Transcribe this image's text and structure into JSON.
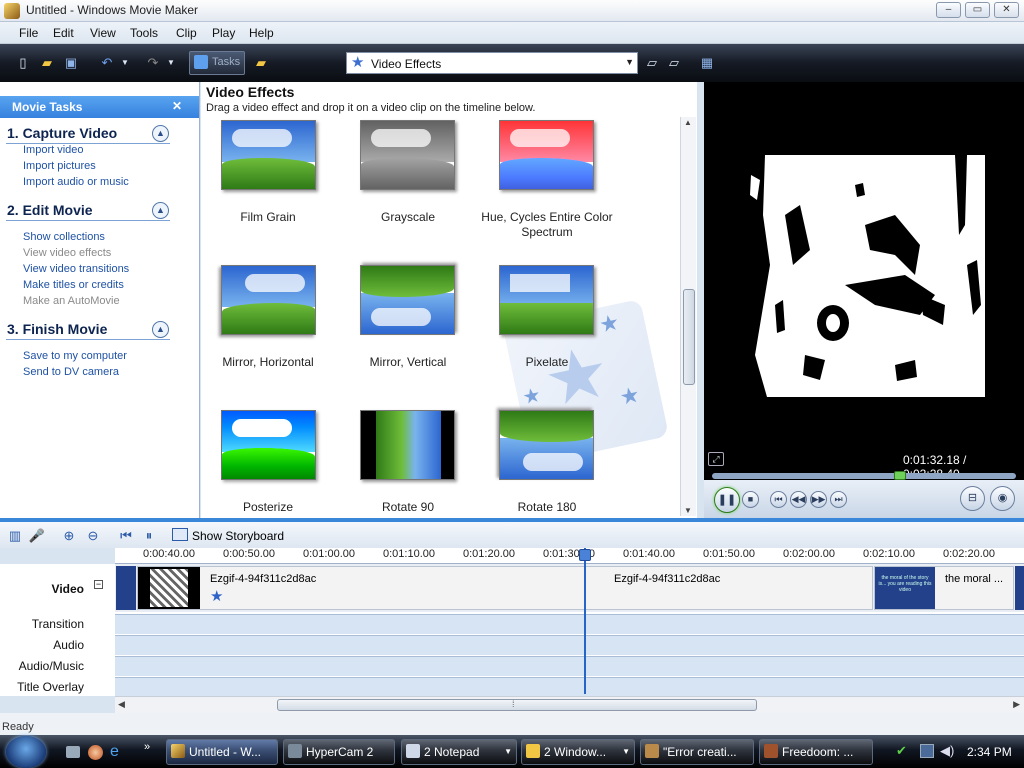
{
  "window": {
    "title": "Untitled - Windows Movie Maker",
    "minimize": "–",
    "maximize": "▭",
    "close": "✕"
  },
  "menu": [
    "File",
    "Edit",
    "View",
    "Tools",
    "Clip",
    "Play",
    "Help"
  ],
  "toolbar": {
    "tasks_label": "Tasks",
    "collections_select": "Video Effects"
  },
  "movie_tasks": {
    "header": "Movie Tasks",
    "sections": [
      {
        "title": "1. Capture Video",
        "links": [
          {
            "label": "Import video",
            "enabled": true
          },
          {
            "label": "Import pictures",
            "enabled": true
          },
          {
            "label": "Import audio or music",
            "enabled": true
          }
        ]
      },
      {
        "title": "2. Edit Movie",
        "links": [
          {
            "label": "Show collections",
            "enabled": true
          },
          {
            "label": "View video effects",
            "enabled": false
          },
          {
            "label": "View video transitions",
            "enabled": true
          },
          {
            "label": "Make titles or credits",
            "enabled": true
          },
          {
            "label": "Make an AutoMovie",
            "enabled": false
          }
        ]
      },
      {
        "title": "3. Finish Movie",
        "links": [
          {
            "label": "Save to my computer",
            "enabled": true
          },
          {
            "label": "Send to DV camera",
            "enabled": true
          }
        ]
      }
    ]
  },
  "effects_panel": {
    "title": "Video Effects",
    "subtitle": "Drag a video effect and drop it on a video clip on the timeline below.",
    "effects": [
      "Film Grain",
      "Grayscale",
      "Hue, Cycles Entire Color Spectrum",
      "Mirror, Horizontal",
      "Mirror, Vertical",
      "Pixelate",
      "Posterize",
      "Rotate 90",
      "Rotate 180"
    ]
  },
  "preview": {
    "timecode": "0:01:32.18 / 0:02:28.40"
  },
  "timeline": {
    "show_storyboard": "Show Storyboard",
    "ruler_ticks": [
      "0:00:40.00",
      "0:00:50.00",
      "0:01:00.00",
      "0:01:10.00",
      "0:01:20.00",
      "0:01:30.00",
      "0:01:40.00",
      "0:01:50.00",
      "0:02:00.00",
      "0:02:10.00",
      "0:02:20.00"
    ],
    "tracks": [
      "Video",
      "Transition",
      "Audio",
      "Audio/Music",
      "Title Overlay"
    ],
    "clips": [
      "Ezgif-4-94f311c2d8ac",
      "Ezgif-4-94f311c2d8ac",
      "the moral ...",
      "the moral of the story is... you are reading this video"
    ],
    "video_expand": "−"
  },
  "status": "Ready",
  "taskbar": {
    "buttons": [
      "Untitled - W...",
      "HyperCam 2",
      "2 Notepad",
      "2 Window...",
      "\"Error creati...",
      "Freedoom: ..."
    ],
    "clock": "2:34 PM"
  }
}
